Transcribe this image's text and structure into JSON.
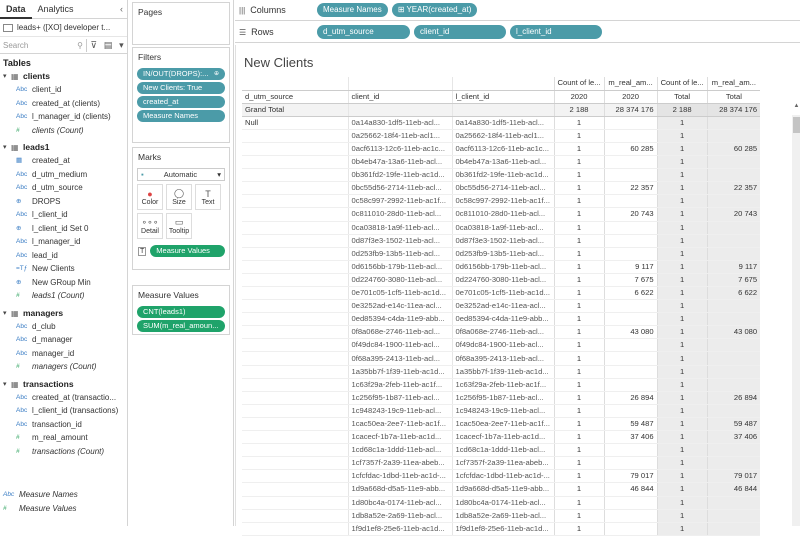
{
  "left": {
    "tabs": [
      "Data",
      "Analytics"
    ],
    "close": "‹",
    "datasource": "leads+ ([XO] developer t...",
    "search_placeholder": "Search",
    "tables_heading": "Tables",
    "groups": [
      {
        "name": "clients",
        "fields": [
          {
            "type": "Abc",
            "label": "client_id",
            "measure": false,
            "italic": false
          },
          {
            "type": "Abc",
            "label": "created_at (clients)",
            "measure": false,
            "italic": false
          },
          {
            "type": "Abc",
            "label": "l_manager_id (clients)",
            "measure": false,
            "italic": false
          },
          {
            "type": "#",
            "label": "clients (Count)",
            "measure": true,
            "italic": true
          }
        ]
      },
      {
        "name": "leads1",
        "fields": [
          {
            "type": "▦",
            "label": "created_at",
            "measure": false,
            "italic": false
          },
          {
            "type": "Abc",
            "label": "d_utm_medium",
            "measure": false,
            "italic": false
          },
          {
            "type": "Abc",
            "label": "d_utm_source",
            "measure": false,
            "italic": false
          },
          {
            "type": "⊕",
            "label": "DROPS",
            "measure": false,
            "italic": false
          },
          {
            "type": "Abc",
            "label": "l_client_id",
            "measure": false,
            "italic": false
          },
          {
            "type": "⊕",
            "label": "l_client_id Set 0",
            "measure": false,
            "italic": false
          },
          {
            "type": "Abc",
            "label": "l_manager_id",
            "measure": false,
            "italic": false
          },
          {
            "type": "Abc",
            "label": "lead_id",
            "measure": false,
            "italic": false
          },
          {
            "type": "=Tƒ",
            "label": "New Clients",
            "measure": false,
            "italic": false
          },
          {
            "type": "⊕",
            "label": "New GRoup Min",
            "measure": false,
            "italic": false
          },
          {
            "type": "#",
            "label": "leads1 (Count)",
            "measure": true,
            "italic": true
          }
        ]
      },
      {
        "name": "managers",
        "fields": [
          {
            "type": "Abc",
            "label": "d_club",
            "measure": false,
            "italic": false
          },
          {
            "type": "Abc",
            "label": "d_manager",
            "measure": false,
            "italic": false
          },
          {
            "type": "Abc",
            "label": "manager_id",
            "measure": false,
            "italic": false
          },
          {
            "type": "#",
            "label": "managers (Count)",
            "measure": true,
            "italic": true
          }
        ]
      },
      {
        "name": "transactions",
        "fields": [
          {
            "type": "Abc",
            "label": "created_at (transactio...",
            "measure": false,
            "italic": false
          },
          {
            "type": "Abc",
            "label": "l_client_id (transactions)",
            "measure": false,
            "italic": false
          },
          {
            "type": "Abc",
            "label": "transaction_id",
            "measure": false,
            "italic": false
          },
          {
            "type": "#",
            "label": "m_real_amount",
            "measure": true,
            "italic": false
          },
          {
            "type": "#",
            "label": "transactions (Count)",
            "measure": true,
            "italic": true
          }
        ]
      }
    ],
    "bottom": [
      {
        "type": "Abc",
        "label": "Measure Names"
      },
      {
        "type": "#",
        "label": "Measure Values"
      }
    ]
  },
  "cards": {
    "pages": "Pages",
    "filters": "Filters",
    "filter_pills": [
      "IN/OUT(DROPS):...",
      "New Clients: True",
      "created_at",
      "Measure Names"
    ],
    "marks": "Marks",
    "marks_type": "Automatic",
    "mark_buttons": [
      {
        "icon": "●",
        "label": "Color"
      },
      {
        "icon": "◯",
        "label": "Size"
      },
      {
        "icon": "T",
        "label": "Text"
      },
      {
        "icon": "∘∘∘",
        "label": "Detail"
      },
      {
        "icon": "▭",
        "label": "Tooltip"
      }
    ],
    "marks_pill": "Measure Values",
    "measure_values": "Measure Values",
    "mv_pills": [
      "CNT(leads1)",
      "SUM(m_real_amoun..."
    ]
  },
  "shelves": {
    "columns_label": "Columns",
    "columns": [
      "Measure Names",
      "YEAR(created_at)"
    ],
    "rows_label": "Rows",
    "rows": [
      "d_utm_source",
      "client_id",
      "l_client_id"
    ]
  },
  "view": {
    "title": "New Clients",
    "headers": {
      "row1": [
        "",
        "",
        "",
        "Count of le...",
        "m_real_am...",
        "Count of le...",
        "m_real_am..."
      ],
      "row2": [
        "d_utm_source",
        "client_id",
        "l_client_id",
        "2020",
        "2020",
        "Total",
        "Total"
      ]
    },
    "grand_total": [
      "Grand Total",
      "",
      "",
      "2 188",
      "28 374 176",
      "2 188",
      "28 374 176"
    ],
    "rows": [
      [
        "Null",
        "0a14a830-1df5-11eb-acl...",
        "0a14a830-1df5-11eb-acl...",
        "1",
        "",
        "1",
        ""
      ],
      [
        "",
        "0a25662-18f4-11eb-acl1...",
        "0a25662-18f4-11eb-acl1...",
        "1",
        "",
        "1",
        ""
      ],
      [
        "",
        "0acf6113-12c6-11eb-ac1c...",
        "0acf6113-12c6-11eb-ac1c...",
        "1",
        "60 285",
        "1",
        "60 285"
      ],
      [
        "",
        "0b4eb47a-13a6-11eb-acl...",
        "0b4eb47a-13a6-11eb-acl...",
        "1",
        "",
        "1",
        ""
      ],
      [
        "",
        "0b361fd2-19fe-11eb-ac1d...",
        "0b361fd2-19fe-11eb-ac1d...",
        "1",
        "",
        "1",
        ""
      ],
      [
        "",
        "0bc55d56-2714-11eb-acl...",
        "0bc55d56-2714-11eb-acl...",
        "1",
        "22 357",
        "1",
        "22 357"
      ],
      [
        "",
        "0c58c997-2992-11eb-ac1f...",
        "0c58c997-2992-11eb-ac1f...",
        "1",
        "",
        "1",
        ""
      ],
      [
        "",
        "0c811010-28d0-11eb-acl...",
        "0c811010-28d0-11eb-acl...",
        "1",
        "20 743",
        "1",
        "20 743"
      ],
      [
        "",
        "0ca03818-1a9f-11eb-acl...",
        "0ca03818-1a9f-11eb-acl...",
        "1",
        "",
        "1",
        ""
      ],
      [
        "",
        "0d87f3e3-1502-11eb-acl...",
        "0d87f3e3-1502-11eb-acl...",
        "1",
        "",
        "1",
        ""
      ],
      [
        "",
        "0d253fb9-13b5-11eb-acl...",
        "0d253fb9-13b5-11eb-acl...",
        "1",
        "",
        "1",
        ""
      ],
      [
        "",
        "0d6156bb-179b-11eb-acl...",
        "0d6156bb-179b-11eb-acl...",
        "1",
        "9 117",
        "1",
        "9 117"
      ],
      [
        "",
        "0d224760-3080-11eb-acl...",
        "0d224760-3080-11eb-acl...",
        "1",
        "7 675",
        "1",
        "7 675"
      ],
      [
        "",
        "0e701c05-1cf5-11eb-ac1d...",
        "0e701c05-1cf5-11eb-ac1d...",
        "1",
        "6 622",
        "1",
        "6 622"
      ],
      [
        "",
        "0e3252ad-e14c-11ea-acl...",
        "0e3252ad-e14c-11ea-acl...",
        "1",
        "",
        "1",
        ""
      ],
      [
        "",
        "0ed85394-c4da-11e9-abb...",
        "0ed85394-c4da-11e9-abb...",
        "1",
        "",
        "1",
        ""
      ],
      [
        "",
        "0f8a068e-2746-11eb-acl...",
        "0f8a068e-2746-11eb-acl...",
        "1",
        "43 080",
        "1",
        "43 080"
      ],
      [
        "",
        "0f49dc84-1900-11eb-acl...",
        "0f49dc84-1900-11eb-acl...",
        "1",
        "",
        "1",
        ""
      ],
      [
        "",
        "0f68a395-2413-11eb-acl...",
        "0f68a395-2413-11eb-acl...",
        "1",
        "",
        "1",
        ""
      ],
      [
        "",
        "1a35bb7f-1f39-11eb-ac1d...",
        "1a35bb7f-1f39-11eb-ac1d...",
        "1",
        "",
        "1",
        ""
      ],
      [
        "",
        "1c63f29a-2feb-11eb-ac1f...",
        "1c63f29a-2feb-11eb-ac1f...",
        "1",
        "",
        "1",
        ""
      ],
      [
        "",
        "1c256f95-1b87-11eb-acl...",
        "1c256f95-1b87-11eb-acl...",
        "1",
        "26 894",
        "1",
        "26 894"
      ],
      [
        "",
        "1c948243-19c9-11eb-acl...",
        "1c948243-19c9-11eb-acl...",
        "1",
        "",
        "1",
        ""
      ],
      [
        "",
        "1cac50ea-2ee7-11eb-ac1f...",
        "1cac50ea-2ee7-11eb-ac1f...",
        "1",
        "59 487",
        "1",
        "59 487"
      ],
      [
        "",
        "1cacecf-1b7a-11eb-ac1d...",
        "1cacecf-1b7a-11eb-ac1d...",
        "1",
        "37 406",
        "1",
        "37 406"
      ],
      [
        "",
        "1cd68c1a-1ddd-11eb-acl...",
        "1cd68c1a-1ddd-11eb-acl...",
        "1",
        "",
        "1",
        ""
      ],
      [
        "",
        "1cf7357f-2a39-11ea-abeb...",
        "1cf7357f-2a39-11ea-abeb...",
        "1",
        "",
        "1",
        ""
      ],
      [
        "",
        "1cfcfdac-1dbd-11eb-ac1d-...",
        "1cfcfdac-1dbd-11eb-ac1d-...",
        "1",
        "79 017",
        "1",
        "79 017"
      ],
      [
        "",
        "1d9a668d-d5a5-11e9-abb...",
        "1d9a668d-d5a5-11e9-abb...",
        "1",
        "46 844",
        "1",
        "46 844"
      ],
      [
        "",
        "1d80bc4a-0174-11eb-acl...",
        "1d80bc4a-0174-11eb-acl...",
        "1",
        "",
        "1",
        ""
      ],
      [
        "",
        "1db8a52e-2a69-11eb-acl...",
        "1db8a52e-2a69-11eb-acl...",
        "1",
        "",
        "1",
        ""
      ],
      [
        "",
        "1f9d1ef8-25e6-11eb-ac1d...",
        "1f9d1ef8-25e6-11eb-ac1d...",
        "1",
        "",
        "1",
        ""
      ]
    ]
  }
}
